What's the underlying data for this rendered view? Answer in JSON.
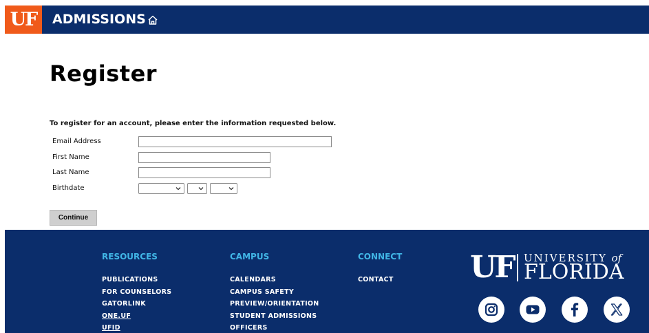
{
  "header": {
    "logo_text": "UF",
    "site_title": "ADMISSIONS",
    "home_icon": "home-icon"
  },
  "main": {
    "title": "Register",
    "intro": "To register for an account, please enter the information requested below.",
    "fields": {
      "email_label": "Email Address",
      "first_name_label": "First Name",
      "last_name_label": "Last Name",
      "birthdate_label": "Birthdate"
    },
    "continue_label": "Continue"
  },
  "footer": {
    "resources": {
      "title": "RESOURCES",
      "links": [
        "PUBLICATIONS",
        "FOR COUNSELORS",
        "GATORLINK",
        "ONE.UF",
        "UFID"
      ]
    },
    "campus": {
      "title": "CAMPUS",
      "links": [
        "CALENDARS",
        "CAMPUS SAFETY",
        "PREVIEW/ORIENTATION",
        "STUDENT ADMISSIONS",
        "OFFICERS"
      ]
    },
    "connect": {
      "title": "CONNECT",
      "links": [
        "CONTACT"
      ]
    },
    "wordmark": {
      "uf": "UF",
      "university": "UNIVERSITY",
      "of": "of",
      "florida": "FLORIDA"
    },
    "social_icons": [
      "instagram-icon",
      "youtube-icon",
      "facebook-icon",
      "x-icon"
    ]
  },
  "colors": {
    "brand_blue": "#0b2d6b",
    "brand_orange": "#f05a1a",
    "footer_heading": "#41b6e6"
  }
}
